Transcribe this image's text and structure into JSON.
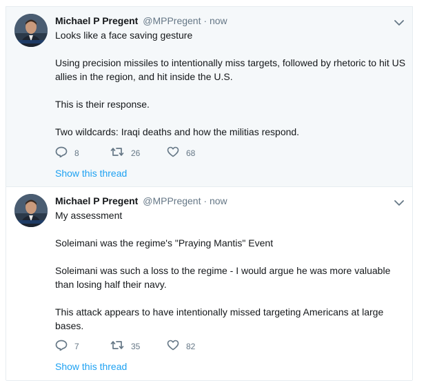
{
  "colors": {
    "accent": "#1da1f2",
    "secondary_text": "#657786",
    "highlight_bg": "#f5f8fa",
    "border": "#e6ecf0"
  },
  "tweets": [
    {
      "author": {
        "name": "Michael P Pregent",
        "handle": "@MPPregent",
        "avatar_icon": "profile-photo"
      },
      "separator": "·",
      "time": "now",
      "paragraphs": [
        "Looks like a face saving gesture",
        "Using precision missiles to intentionally miss targets, followed by rhetoric to hit US allies in the region, and hit inside the U.S.",
        "This is their response.",
        "Two wildcards:  Iraqi deaths and how the militias respond."
      ],
      "replies": "8",
      "retweets": "26",
      "likes": "68",
      "thread_link": "Show this thread"
    },
    {
      "author": {
        "name": "Michael P Pregent",
        "handle": "@MPPregent",
        "avatar_icon": "profile-photo"
      },
      "separator": "·",
      "time": "now",
      "paragraphs": [
        "My assessment",
        "Soleimani was the regime's \"Praying Mantis\" Event",
        "Soleimani was such a loss to the regime - I would argue he was more valuable than losing half their navy.",
        "This attack appears to have intentionally missed targeting Americans at large bases."
      ],
      "replies": "7",
      "retweets": "35",
      "likes": "82",
      "thread_link": "Show this thread"
    }
  ]
}
